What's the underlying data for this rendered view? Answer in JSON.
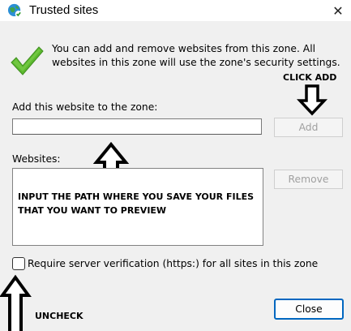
{
  "window": {
    "title": "Trusted sites",
    "close_glyph": "✕"
  },
  "intro_text": "You can add and remove websites from this zone. All websites in this zone will use the zone's security settings.",
  "add_label": "Add this website to the zone:",
  "add_input": {
    "value": "",
    "placeholder": ""
  },
  "add_button": "Add",
  "websites_label": "Websites:",
  "websites_note": "INPUT THE PATH WHERE YOU SAVE YOUR FILES THAT YOU WANT TO PREVIEW",
  "remove_button": "Remove",
  "https_checkbox": {
    "label": "Require server verification (https:) for all sites in this zone",
    "checked": false
  },
  "close_button": "Close",
  "annotations": {
    "click_add": "CLICK ADD",
    "uncheck": "UNCHECK"
  },
  "colors": {
    "accent": "#0067c0",
    "check_green": "#5cb82e",
    "dialog_bg": "#f0f0f0"
  },
  "icons": [
    "internet-globe-icon",
    "green-check-icon",
    "close-icon",
    "down-arrow-icon",
    "up-arrow-icon"
  ]
}
